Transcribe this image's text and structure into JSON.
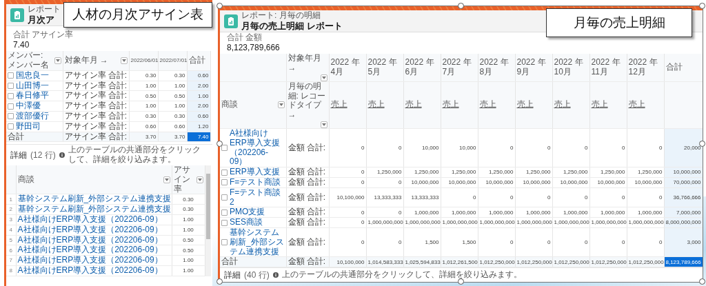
{
  "left_report": {
    "header": {
      "subtitle": "レポート",
      "title": "月次ア"
    },
    "summary": {
      "label": "合計 アサイン率",
      "value": "7.40"
    },
    "table": {
      "columns": [
        "メンバー: メンバー名",
        "対象年月 →",
        "2022/06/01",
        "2022/07/01",
        "合計"
      ],
      "rows": [
        {
          "name": "国忠良一",
          "measure": "アサイン率 合計:",
          "values": [
            "0.30",
            "0.30"
          ],
          "total": "0.60",
          "checked": false
        },
        {
          "name": "山田博一",
          "measure": "アサイン率 合計:",
          "values": [
            "1.00",
            "1.00"
          ],
          "total": "2.00",
          "checked": false
        },
        {
          "name": "春日修平",
          "measure": "アサイン率 合計:",
          "values": [
            "0.50",
            "0.50"
          ],
          "total": "1.00",
          "checked": false
        },
        {
          "name": "中澤優",
          "measure": "アサイン率 合計:",
          "values": [
            "1.00",
            "1.00"
          ],
          "total": "2.00",
          "checked": false
        },
        {
          "name": "渡部優行",
          "measure": "アサイン率 合計:",
          "values": [
            "0.30",
            "0.30"
          ],
          "total": "0.60",
          "checked": false
        },
        {
          "name": "野田司",
          "measure": "アサイン率 合計:",
          "values": [
            "0.60",
            "0.60"
          ],
          "total": "1.20",
          "checked": false
        }
      ],
      "total_row": {
        "label": "合計",
        "measure": "アサイン率 合計:",
        "values": [
          "3.70",
          "3.70"
        ],
        "total": "7.40",
        "selected": true
      }
    },
    "details": {
      "label": "詳細",
      "count": "(12 行)",
      "hint": "上のテーブルの共通部分をクリックして、詳細を絞り込みます。",
      "columns": [
        "商談",
        "アサイン率"
      ],
      "rows": [
        {
          "number": "1",
          "deal": "基幹システム刷新_外部システム連携支援",
          "value": "0.30"
        },
        {
          "number": "2",
          "deal": "基幹システム刷新_外部システム連携支援",
          "value": "0.30"
        },
        {
          "number": "3",
          "deal": "A社様向けERP導入支援（202206-09）",
          "value": "1.00"
        },
        {
          "number": "4",
          "deal": "A社様向けERP導入支援（202206-09）",
          "value": "1.00"
        },
        {
          "number": "5",
          "deal": "A社様向けERP導入支援（202206-09）",
          "value": "0.50"
        },
        {
          "number": "6",
          "deal": "A社様向けERP導入支援（202206-09）",
          "value": "0.50"
        },
        {
          "number": "7",
          "deal": "A社様向けERP導入支援（202206-09）",
          "value": "1.00"
        },
        {
          "number": "8",
          "deal": "A社様向けERP導入支援（202206-09）",
          "value": "1.00"
        }
      ]
    }
  },
  "right_report": {
    "header": {
      "subtitle": "レポート: 月毎の明細",
      "title": "月毎の売上明細 レポート"
    },
    "summary": {
      "label": "合計 金額",
      "value": "8,123,789,666"
    },
    "table": {
      "row_header": "商談",
      "column_header": "対象年月 →",
      "measure_header": "月毎の明細: レコードタイプ →",
      "months": [
        "2022 年 4月",
        "2022 年 5月",
        "2022 年 6月",
        "2022 年 7月",
        "2022 年 8月",
        "2022 年 9月",
        "2022 年 10月",
        "2022 年 11月",
        "2022 年 12月"
      ],
      "record_types": [
        "売上",
        "売上",
        "売上",
        "売上",
        "売上",
        "売上",
        "売上",
        "売上",
        "売上"
      ],
      "total_header": "合計",
      "rows": [
        {
          "name": "A社様向けERP導入支援（202206-09）",
          "measure": "金額 合計:",
          "values": [
            "0",
            "0",
            "10,000",
            "10,000",
            "0",
            "0",
            "0",
            "0",
            "0"
          ],
          "total": "20,000",
          "checked": false
        },
        {
          "name": "ERP導入支援",
          "measure": "金額 合計:",
          "values": [
            "0",
            "1,250,000",
            "1,250,000",
            "1,250,000",
            "1,250,000",
            "1,250,000",
            "1,250,000",
            "1,250,000",
            "1,250,000"
          ],
          "total": "10,000,000",
          "checked": false
        },
        {
          "name": "F=テスト商談",
          "measure": "金額 合計:",
          "values": [
            "0",
            "0",
            "10,000,000",
            "10,000,000",
            "10,000,000",
            "10,000,000",
            "10,000,000",
            "10,000,000",
            "10,000,000"
          ],
          "total": "70,000,000",
          "checked": false
        },
        {
          "name": "F=テスト商談2",
          "measure": "金額 合計:",
          "values": [
            "10,100,000",
            "13,333,333",
            "13,333,333",
            "0",
            "0",
            "0",
            "0",
            "0",
            "0"
          ],
          "total": "36,766,666",
          "checked": false
        },
        {
          "name": "PMO支援",
          "measure": "金額 合計:",
          "values": [
            "0",
            "0",
            "1,000,000",
            "1,000,000",
            "1,000,000",
            "1,000,000",
            "1,000,000",
            "1,000,000",
            "1,000,000"
          ],
          "total": "7,000,000",
          "checked": false
        },
        {
          "name": "SES商談",
          "measure": "金額 合計:",
          "values": [
            "0",
            "1,000,000,000",
            "1,000,000,000",
            "1,000,000,000",
            "1,000,000,000",
            "1,000,000,000",
            "1,000,000,000",
            "1,000,000,000",
            "1,000,000,000"
          ],
          "total": "8,000,000,000",
          "checked": false
        },
        {
          "name": "基幹システム刷新_外部システム連携支援",
          "measure": "金額 合計:",
          "values": [
            "0",
            "0",
            "1,500",
            "1,500",
            "0",
            "0",
            "0",
            "0",
            "0"
          ],
          "total": "3,000",
          "checked": false
        }
      ],
      "total_row": {
        "label": "合計",
        "measure": "金額 合計:",
        "values": [
          "10,100,000",
          "1,014,583,333",
          "1,025,594,833",
          "1,012,261,500",
          "1,012,250,000",
          "1,012,250,000",
          "1,012,250,000",
          "1,012,250,000",
          "1,012,250,000"
        ],
        "total": "8,123,789,666",
        "selected": true
      }
    },
    "details": {
      "label": "詳細",
      "count": "(40 行)",
      "hint": "上のテーブルの共通部分をクリックして、詳細を絞り込みます。"
    }
  },
  "callouts": [
    {
      "text": "人材の月次アサイン表"
    },
    {
      "text": "月毎の売上明細"
    }
  ]
}
